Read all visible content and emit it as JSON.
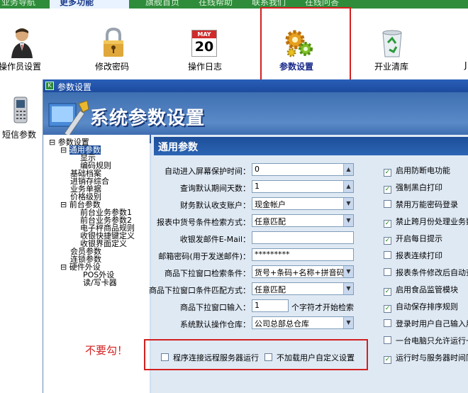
{
  "topbar": {
    "tabs": [
      "业务导航",
      "更多功能",
      "旗舰首页",
      "在线帮助",
      "联系我们",
      "在线问答"
    ]
  },
  "toolbar": {
    "items": [
      {
        "label": "操作员设置",
        "icon": "operator-icon"
      },
      {
        "label": "修改密码",
        "icon": "padlock-icon"
      },
      {
        "label": "操作日志",
        "icon": "calendar-icon",
        "calendar_month": "MAY",
        "calendar_day": "20"
      },
      {
        "label": "参数设置",
        "icon": "gears-icon"
      },
      {
        "label": "开业清库",
        "icon": "recycle-bin-icon"
      }
    ],
    "side_item": {
      "label": "短信参数",
      "icon": "phone-icon"
    }
  },
  "dialog": {
    "title": "参数设置",
    "banner_title": "系统参数设置",
    "panel_title": "通用参数",
    "tree": [
      "参数设置",
      "通用参数",
      "显示",
      "编码规则",
      "基础档案",
      "进销存综合",
      "业务单据",
      "价格级别",
      "前台参数",
      "前台业务参数1",
      "前台业务参数2",
      "电子秤商品规则",
      "收银快捷键定义",
      "收银界面定义",
      "会员参数",
      "连锁参数",
      "硬件外设",
      "POS外设",
      "读/写卡器"
    ],
    "fields": [
      {
        "label": "自动进入屏幕保护时间：",
        "value": "0"
      },
      {
        "label": "查询默认期间天数：",
        "value": "1"
      },
      {
        "label": "财务默认收支账户：",
        "value": "现金帐户"
      },
      {
        "label": "报表中货号条件检索方式：",
        "value": "任意匹配"
      },
      {
        "label": "收银发邮件E-Mail：",
        "value": ""
      },
      {
        "label": "邮箱密码(用于发送邮件)：",
        "value": "*********"
      },
      {
        "label": "商品下拉窗口检索条件：",
        "value": "货号+条码+名称+拼音码"
      },
      {
        "label": "商品下拉窗口条件匹配方式：",
        "value": "任意匹配"
      },
      {
        "label": "商品下拉窗口输入：",
        "value": "1",
        "suffix": "个字符才开始检索"
      },
      {
        "label": "系统默认操作仓库：",
        "value": "公司总部总仓库"
      }
    ],
    "checkboxes": [
      {
        "label": "启用防断电功能",
        "checked": true
      },
      {
        "label": "强制黑白打印",
        "checked": true
      },
      {
        "label": "禁用万能密码登录",
        "checked": false
      },
      {
        "label": "禁止跨月份处理业务数",
        "checked": true
      },
      {
        "label": "开启每日提示",
        "checked": true
      },
      {
        "label": "报表连续打印",
        "checked": false
      },
      {
        "label": "报表条件修改后自动查",
        "checked": false
      },
      {
        "label": "启用食品监管模块",
        "checked": true
      },
      {
        "label": "自动保存排序规则",
        "checked": true
      },
      {
        "label": "登录时用户自己输入用",
        "checked": false
      },
      {
        "label": "一台电脑只允许运行一",
        "checked": false
      },
      {
        "label": "运行时与服务器时间同",
        "checked": true
      }
    ],
    "bottom_checkboxes": [
      {
        "label": "程序连接远程服务器运行",
        "checked": false
      },
      {
        "label": "不加载用户自定义设置",
        "checked": false
      }
    ],
    "annotation": "不要勾！"
  },
  "colors": {
    "accent_red": "#d32020",
    "check_green": "#1a8a1a",
    "title_blue": "#1d4f99"
  }
}
